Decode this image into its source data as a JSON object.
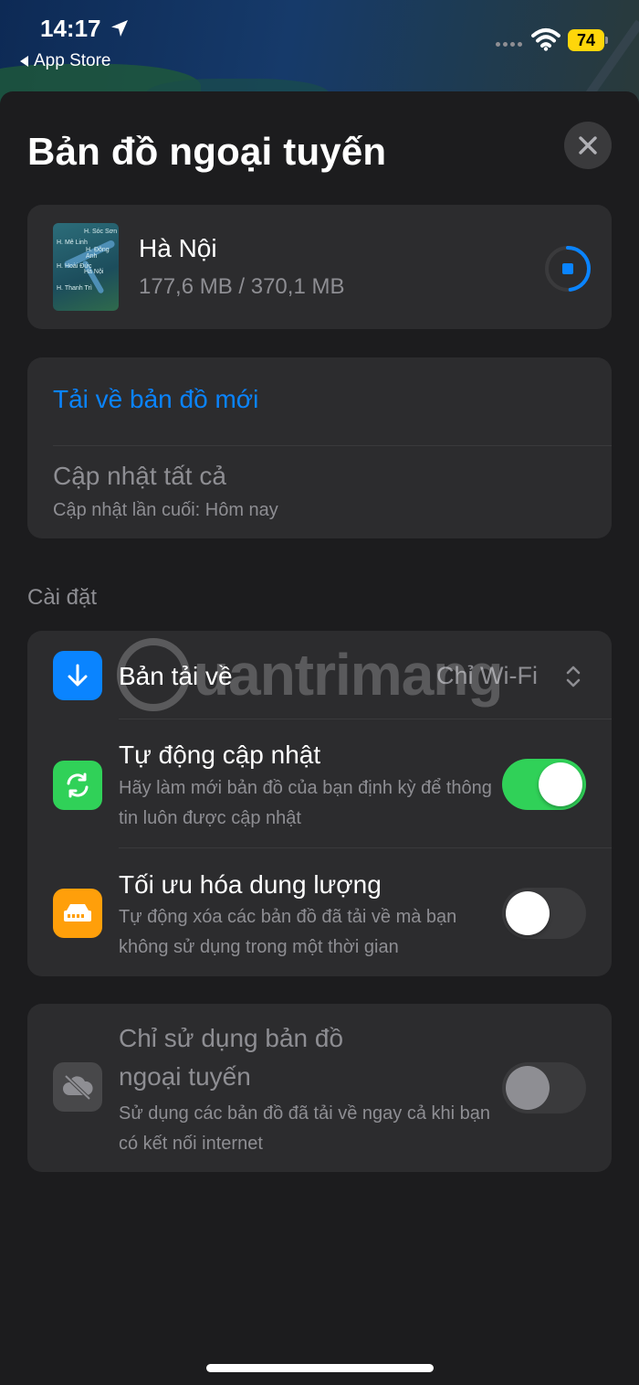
{
  "status_bar": {
    "time": "14:17",
    "back_app": "App Store",
    "battery": "74",
    "battery_color": "#ffd60a"
  },
  "sheet": {
    "title": "Bản đồ ngoại tuyến",
    "close_icon": "xmark-icon"
  },
  "download": {
    "map_name": "Hà Nội",
    "progress_text": "177,6 MB / 370,1 MB",
    "progress_fraction": 0.48,
    "thumb_labels": [
      "H. Sóc Sơn",
      "H. Mê Linh",
      "H. Đông Anh",
      "H. Hoài Đức",
      "Hà Nội",
      "H. Thanh Trì"
    ]
  },
  "actions": {
    "download_new": "Tải về bản đồ mới",
    "update_all": "Cập nhật tất cả",
    "last_update": "Cập nhật lần cuối: Hôm nay"
  },
  "settings": {
    "section_title": "Cài đặt",
    "downloads_label": "Bản tải về",
    "downloads_value": "Chỉ Wi-Fi",
    "auto_update_title": "Tự động cập nhật",
    "auto_update_sub": "Hãy làm mới bản đồ của bạn định kỳ để thông tin luôn được cập nhật",
    "auto_update_on": true,
    "optimize_title": "Tối ưu hóa dung lượng",
    "optimize_sub": "Tự động xóa các bản đồ đã tải về mà bạn không sử dụng trong một thời gian",
    "optimize_on": false
  },
  "offline_only": {
    "title_line1": "Chỉ sử dụng bản đồ",
    "title_line2": "ngoại tuyến",
    "sub": "Sử dụng các bản đồ đã tải về ngay cả khi bạn có kết nối internet",
    "enabled": false
  },
  "watermark": "uantrimang",
  "colors": {
    "accent": "#0a84ff",
    "toggle_on": "#30d158",
    "download_icon_bg": "#0a84ff",
    "auto_update_icon_bg": "#30d158",
    "optimize_icon_bg": "#ff9f0a"
  }
}
